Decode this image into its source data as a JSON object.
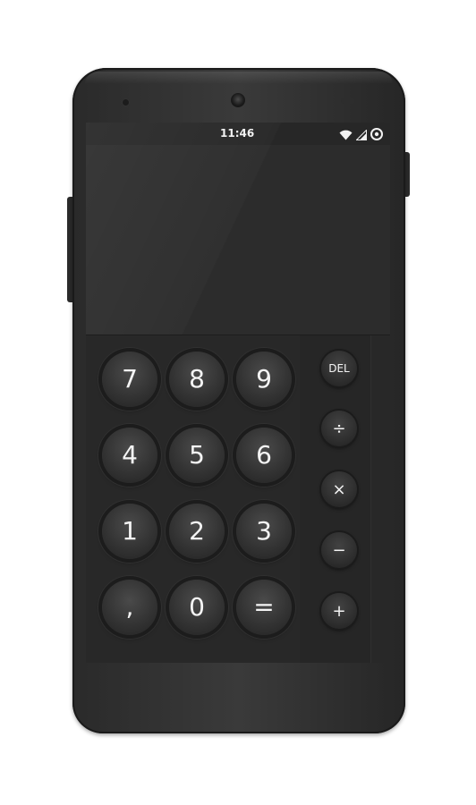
{
  "status_bar": {
    "time": "11:46",
    "icons": [
      "wifi-icon",
      "cellular-signal-icon",
      "battery-icon"
    ]
  },
  "display": {
    "formula": "",
    "result": ""
  },
  "keypad": {
    "digits": [
      [
        "7",
        "8",
        "9"
      ],
      [
        "4",
        "5",
        "6"
      ],
      [
        "1",
        "2",
        "3"
      ],
      [
        ",",
        "0",
        "="
      ]
    ],
    "operators": [
      "DEL",
      "÷",
      "×",
      "−",
      "+"
    ]
  },
  "colors": {
    "device_body": "#2f2f2f",
    "screen_background": "#272727",
    "key_text": "#f4f4f4"
  }
}
